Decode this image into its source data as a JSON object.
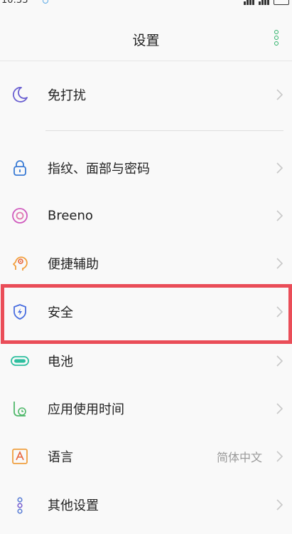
{
  "status_bar": {
    "time": "10:33"
  },
  "header": {
    "title": "设置"
  },
  "menu": {
    "dnd": "免打扰",
    "fingerprint": "指纹、面部与密码",
    "breeno": "Breeno",
    "accessibility": "便捷辅助",
    "security": "安全",
    "battery": "电池",
    "screen_time": "应用使用时间",
    "language": "语言",
    "language_value": "简体中文",
    "other": "其他设置"
  },
  "colors": {
    "accent_green": "#2fb36a",
    "highlight_red": "#ea4d58",
    "moon_purple": "#6a5fd1",
    "lock_blue": "#3a7bd5",
    "breeno_pink": "#d05bbe",
    "accessibility_orange": "#f2a03d",
    "security_blue": "#4a6fe0",
    "battery_teal": "#2ebf9f",
    "screen_time_green": "#4fb86a",
    "language_orange": "#f0a040",
    "other_blue": "#5b7fd6"
  },
  "icons": [
    "moon-icon",
    "lock-icon",
    "breeno-icon",
    "accessibility-icon",
    "shield-icon",
    "battery-icon",
    "alarm-clock-icon",
    "language-icon",
    "other-settings-icon",
    "chevron-right-icon",
    "more-vertical-icon"
  ]
}
